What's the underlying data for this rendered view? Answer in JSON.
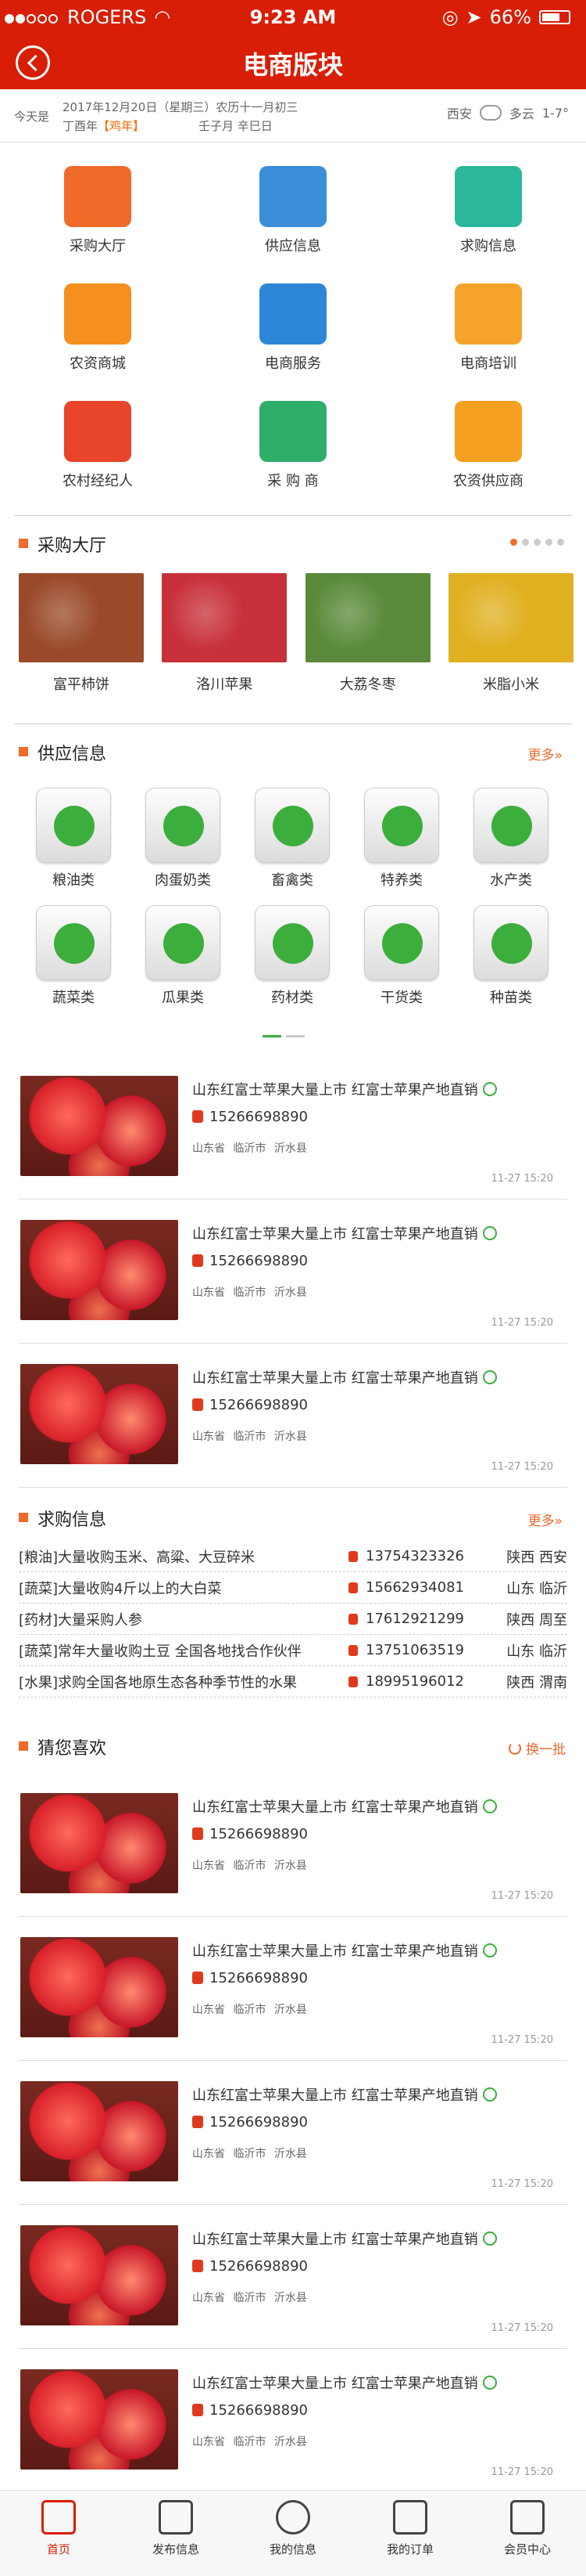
{
  "status_bar": {
    "carrier": "ROGERS",
    "time": "9:23 AM",
    "battery": "66%"
  },
  "nav": {
    "title": "电商版块"
  },
  "date_bar": {
    "label": "今天是",
    "line1": "2017年12月20日（星期三）农历十一月初三",
    "line2_prefix": "丁酉年",
    "line2_zodiac": "【鸡年】",
    "line2_ganzhi": "壬子月   辛巳日",
    "city": "西安",
    "weather": "多云",
    "temperature": "1-7°"
  },
  "categories": [
    {
      "label": "采购大厅",
      "icon": "wheat-bag-icon",
      "color": "#f06a2a"
    },
    {
      "label": "供应信息",
      "icon": "truck-icon",
      "color": "#3a8fd8"
    },
    {
      "label": "求购信息",
      "icon": "shopping-cart-icon",
      "color": "#2bb89a"
    },
    {
      "label": "农资商城",
      "icon": "seed-bag-icon",
      "color": "#f5901e"
    },
    {
      "label": "电商服务",
      "icon": "online-store-icon",
      "color": "#2e86d9"
    },
    {
      "label": "电商培训",
      "icon": "teacher-icon",
      "color": "#f5a32a"
    },
    {
      "label": "农村经纪人",
      "icon": "agent-person-icon",
      "color": "#e8452a"
    },
    {
      "label": "采 购 商",
      "icon": "buyer-documents-icon",
      "color": "#2fae6a"
    },
    {
      "label": "农资供应商",
      "icon": "supplier-people-icon",
      "color": "#f5a020"
    }
  ],
  "purchase_hall": {
    "title": "采购大厅",
    "items": [
      {
        "name": "富平柿饼",
        "color": "#9a4a2a"
      },
      {
        "name": "洛川苹果",
        "color": "#c8303a"
      },
      {
        "name": "大荔冬枣",
        "color": "#5a8a3a"
      },
      {
        "name": "米脂小米",
        "color": "#e0b020"
      }
    ]
  },
  "supply": {
    "title": "供应信息",
    "more": "更多»",
    "items": [
      {
        "label": "粮油类",
        "icon": "oil-bottle-icon"
      },
      {
        "label": "肉蛋奶类",
        "icon": "egg-icon"
      },
      {
        "label": "畜禽类",
        "icon": "cow-icon"
      },
      {
        "label": "特养类",
        "icon": "fox-icon"
      },
      {
        "label": "水产类",
        "icon": "fish-icon"
      },
      {
        "label": "蔬菜类",
        "icon": "eggplant-icon"
      },
      {
        "label": "瓜果类",
        "icon": "cherry-icon"
      },
      {
        "label": "药材类",
        "icon": "herb-leaf-icon"
      },
      {
        "label": "干货类",
        "icon": "mushroom-icon"
      },
      {
        "label": "种苗类",
        "icon": "flower-seedling-icon"
      }
    ]
  },
  "supply_products": [
    {
      "title": "山东红富士苹果大量上市 红富士苹果产地直销",
      "phone": "15266698890",
      "location": "山东省 临沂市 沂水县",
      "time": "11-27 15:20"
    },
    {
      "title": "山东红富士苹果大量上市 红富士苹果产地直销",
      "phone": "15266698890",
      "location": "山东省 临沂市 沂水县",
      "time": "11-27 15:20"
    },
    {
      "title": "山东红富士苹果大量上市 红富士苹果产地直销",
      "phone": "15266698890",
      "location": "山东省 临沂市 沂水县",
      "time": "11-27 15:20"
    }
  ],
  "wanted": {
    "title": "求购信息",
    "more": "更多»",
    "rows": [
      {
        "text": "[粮油]大量收购玉米、高粱、大豆碎米",
        "phone": "13754323326",
        "region": "陕西 西安"
      },
      {
        "text": "[蔬菜]大量收购4斤以上的大白菜",
        "phone": "15662934081",
        "region": "山东 临沂"
      },
      {
        "text": "[药材]大量采购人参",
        "phone": "17612921299",
        "region": "陕西 周至"
      },
      {
        "text": "[蔬菜]常年大量收购土豆 全国各地找合作伙伴",
        "phone": "13751063519",
        "region": "山东 临沂"
      },
      {
        "text": "[水果]求购全国各地原生态各种季节性的水果",
        "phone": "18995196012",
        "region": "陕西 渭南"
      }
    ]
  },
  "guess": {
    "title": "猜您喜欢",
    "refresh": "换一批",
    "products": [
      {
        "title": "山东红富士苹果大量上市 红富士苹果产地直销",
        "phone": "15266698890",
        "location": "山东省 临沂市 沂水县",
        "time": "11-27 15:20"
      },
      {
        "title": "山东红富士苹果大量上市 红富士苹果产地直销",
        "phone": "15266698890",
        "location": "山东省 临沂市 沂水县",
        "time": "11-27 15:20"
      },
      {
        "title": "山东红富士苹果大量上市 红富士苹果产地直销",
        "phone": "15266698890",
        "location": "山东省 临沂市 沂水县",
        "time": "11-27 15:20"
      },
      {
        "title": "山东红富士苹果大量上市 红富士苹果产地直销",
        "phone": "15266698890",
        "location": "山东省 临沂市 沂水县",
        "time": "11-27 15:20"
      },
      {
        "title": "山东红富士苹果大量上市 红富士苹果产地直销",
        "phone": "15266698890",
        "location": "山东省 临沂市 沂水县",
        "time": "11-27 15:20"
      }
    ]
  },
  "tabbar": [
    {
      "label": "首页",
      "icon": "home-icon",
      "active": true
    },
    {
      "label": "发布信息",
      "icon": "edit-icon",
      "active": false
    },
    {
      "label": "我的信息",
      "icon": "user-icon",
      "active": false
    },
    {
      "label": "我的订单",
      "icon": "order-list-icon",
      "active": false
    },
    {
      "label": "会员中心",
      "icon": "crown-icon",
      "active": false
    }
  ]
}
